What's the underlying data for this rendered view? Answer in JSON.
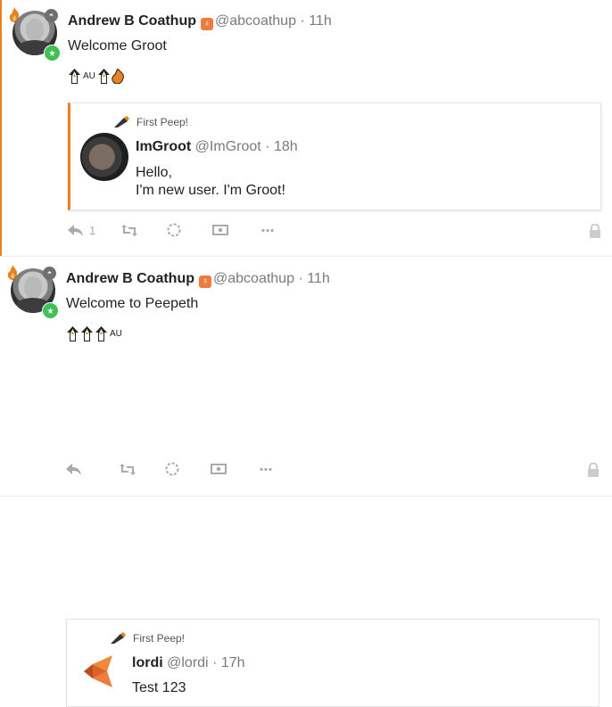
{
  "peeps": [
    {
      "author": {
        "name": "Andrew B Coathup",
        "handle": "@abcoathup",
        "time": "11h",
        "github_icon": "github-badge-icon"
      },
      "text": "Welcome Groot",
      "badges": [
        "penguin-badge",
        "AU",
        "penguin-badge",
        "flame-badge"
      ],
      "quote": {
        "label": "First Peep!",
        "author": {
          "name": "ImGroot",
          "handle": "@ImGroot",
          "time": "18h"
        },
        "text_lines": [
          "Hello,",
          "I'm new user. I'm Groot!"
        ]
      },
      "actions": {
        "reply_count": "1"
      }
    },
    {
      "author": {
        "name": "Andrew B Coathup",
        "handle": "@abcoathup",
        "time": "11h",
        "github_icon": "github-badge-icon"
      },
      "text": "Welcome to Peepeth",
      "badges": [
        "penguin-badge",
        "penguin-badge",
        "penguin-badge",
        "AU"
      ],
      "quote": {
        "label": "First Peep!",
        "author": {
          "name": "lordi",
          "handle": "@lordi",
          "time": "17h"
        },
        "text_lines": [
          "Test 123"
        ]
      },
      "actions": {
        "reply_count": ""
      }
    }
  ],
  "separator": "·",
  "colors": {
    "accent": "#e8821e",
    "muted": "#aaaaaa",
    "badge_green": "#40c157",
    "github": "#ee7d3d"
  },
  "icons": [
    "reply-icon",
    "reshare-icon",
    "love-icon",
    "tip-icon",
    "more-icon",
    "lock-icon"
  ]
}
